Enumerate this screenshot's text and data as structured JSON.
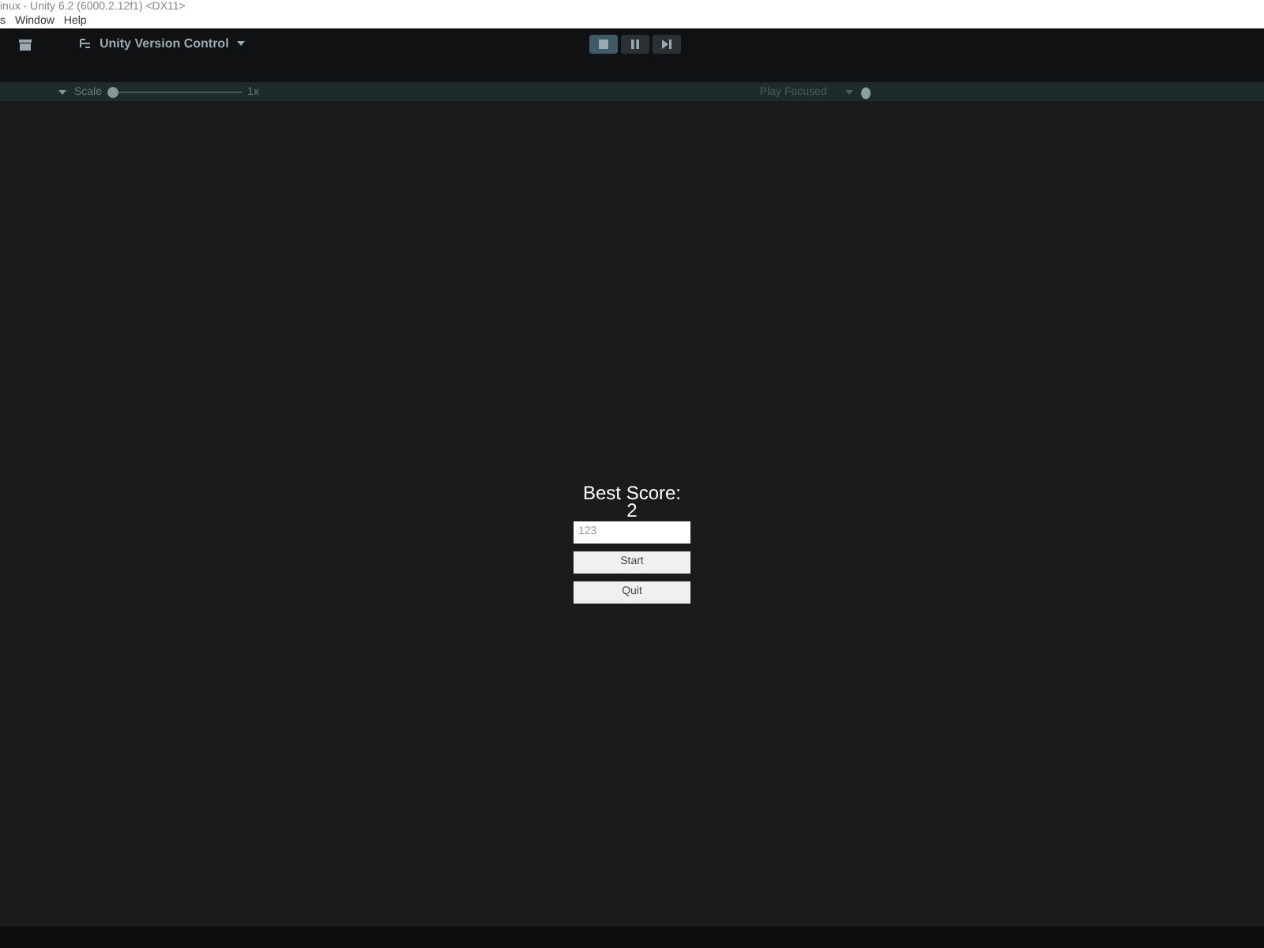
{
  "window": {
    "title": "inux - Unity 6.2 (6000.2.12f1) <DX11>"
  },
  "menu": [
    "s",
    "Window",
    "Help"
  ],
  "toolbar": {
    "version_control": "Unity Version Control",
    "play_controls": [
      {
        "kind": "stop",
        "selected": true
      },
      {
        "kind": "pause",
        "selected": false
      },
      {
        "kind": "step",
        "selected": false
      }
    ]
  },
  "game_bar": {
    "scale_label": "Scale",
    "scale": {
      "level": 0.0
    },
    "scale_reading": "1x",
    "play_mode": "Play Focused"
  },
  "game": {
    "heading": "Best Score:",
    "score": "2",
    "name_field": {
      "value": "123"
    },
    "buttons": [
      "Start",
      "Quit"
    ]
  }
}
